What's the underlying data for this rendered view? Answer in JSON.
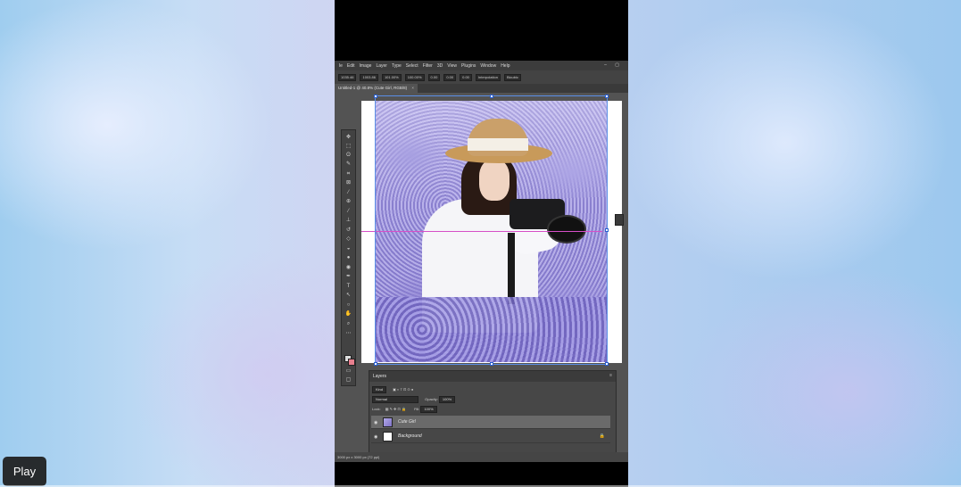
{
  "menubar": {
    "items": [
      "le",
      "Edit",
      "Image",
      "Layer",
      "Type",
      "Select",
      "Filter",
      "3D",
      "View",
      "Plugins",
      "Window",
      "Help"
    ]
  },
  "options": {
    "x_value": "1035.46",
    "y_value": "1003.86",
    "w_value": "101.00%",
    "h_value": "100.00%",
    "angle_value": "0.00",
    "h_skew_value": "0.00",
    "v_skew_value": "0.00",
    "interpolation": "Interpolation",
    "bicubic": "Bicubic"
  },
  "document": {
    "tab_title": "Untitled-1 @ 40.8% (Cute Girl, RGB/8)",
    "close_glyph": "×"
  },
  "layers_panel": {
    "title": "Layers",
    "filter_kind": "Kind",
    "blend_mode": "Normal",
    "opacity_label": "Opacity:",
    "opacity_value": "100%",
    "lock_label": "Lock:",
    "fill_label": "Fill:",
    "fill_value": "100%",
    "layers": [
      {
        "name": "Cute Girl",
        "selected": true
      },
      {
        "name": "Background",
        "selected": false,
        "locked": true
      }
    ]
  },
  "status": {
    "doc_info": "3000 px x 3000 px (72 ppi)"
  },
  "player": {
    "play_label": "Play"
  },
  "colors": {
    "guide": "#d64fc7",
    "selection": "#5a8ee6",
    "foreground_swatch": "#dddddd",
    "background_swatch": "#e87f8e"
  },
  "icons": [
    "move-icon",
    "marquee-icon",
    "lasso-icon",
    "quick-select-icon",
    "crop-icon",
    "frame-icon",
    "eyedropper-icon",
    "healing-brush-icon",
    "brush-icon",
    "clone-stamp-icon",
    "history-brush-icon",
    "eraser-icon",
    "paint-bucket-icon",
    "blur-icon",
    "dodge-icon",
    "pen-icon",
    "type-icon",
    "path-select-icon",
    "shape-icon",
    "hand-icon",
    "zoom-icon",
    "eye-icon",
    "lock-icon"
  ]
}
